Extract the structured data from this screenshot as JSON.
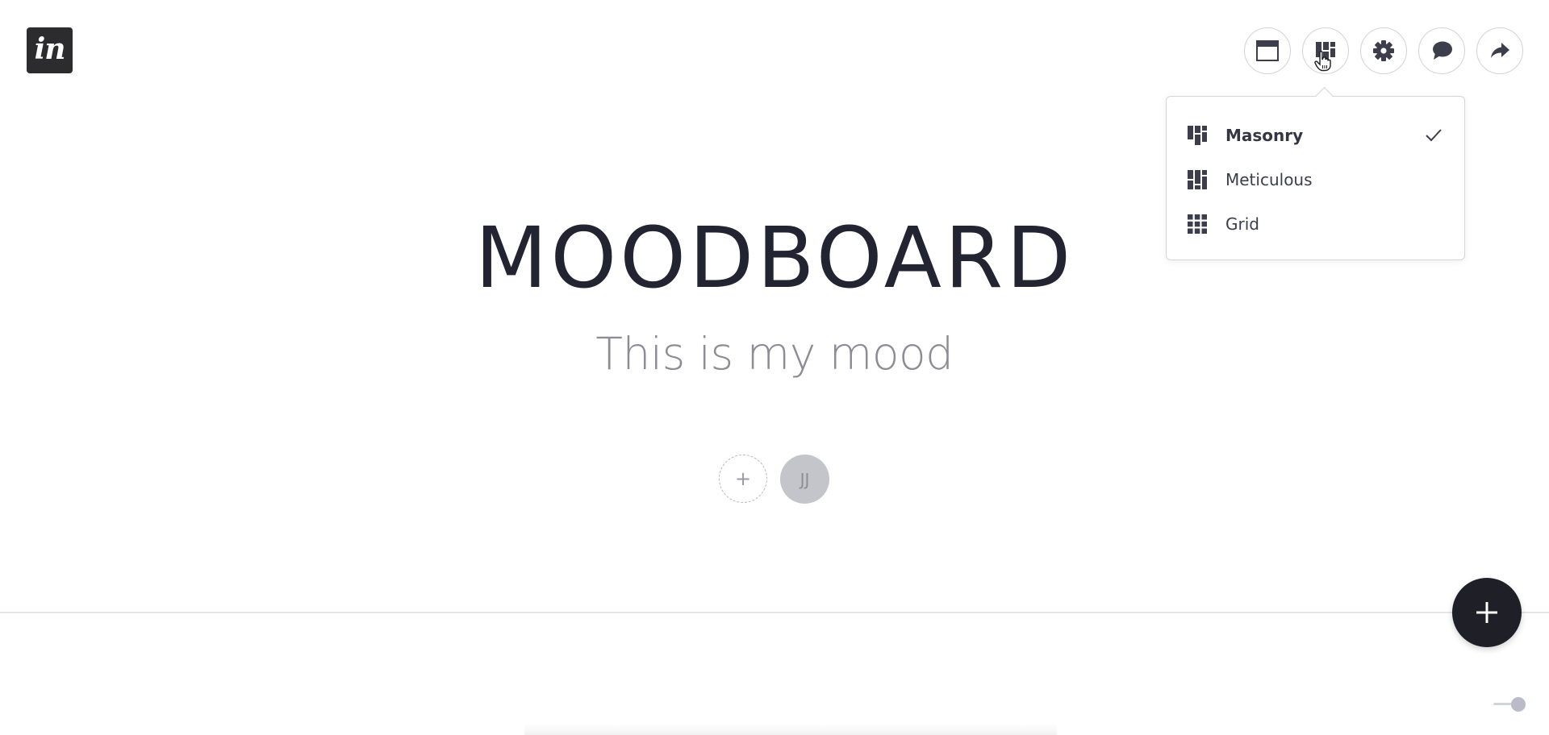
{
  "app": {
    "logo_text": "in",
    "brand_color": "#2c2c2e"
  },
  "toolbar": {
    "buttons": [
      {
        "name": "presentation-mode",
        "icon": "window-icon"
      },
      {
        "name": "layout",
        "icon": "masonry-layout-icon",
        "active": true
      },
      {
        "name": "settings",
        "icon": "gear-icon"
      },
      {
        "name": "comments",
        "icon": "speech-bubble-icon"
      },
      {
        "name": "share",
        "icon": "share-arrow-icon"
      }
    ]
  },
  "layout_menu": {
    "items": [
      {
        "label": "Masonry",
        "icon": "masonry-icon",
        "selected": true
      },
      {
        "label": "Meticulous",
        "icon": "meticulous-icon",
        "selected": false
      },
      {
        "label": "Grid",
        "icon": "grid-icon",
        "selected": false
      }
    ],
    "selected_marker": "check-icon"
  },
  "board": {
    "title": "MOODBOARD",
    "subtitle": "This is my mood"
  },
  "collaborators": {
    "add_symbol": "+",
    "members": [
      {
        "initials": "JJ"
      }
    ]
  },
  "fab": {
    "icon": "plus-icon"
  },
  "zoom": {
    "level": 1.0
  },
  "colors": {
    "text_primary": "#232431",
    "text_muted": "#8b8c95",
    "icon": "#3d3e4c",
    "fab_bg": "#1f2027",
    "avatar_bg": "#c3c5ca"
  }
}
